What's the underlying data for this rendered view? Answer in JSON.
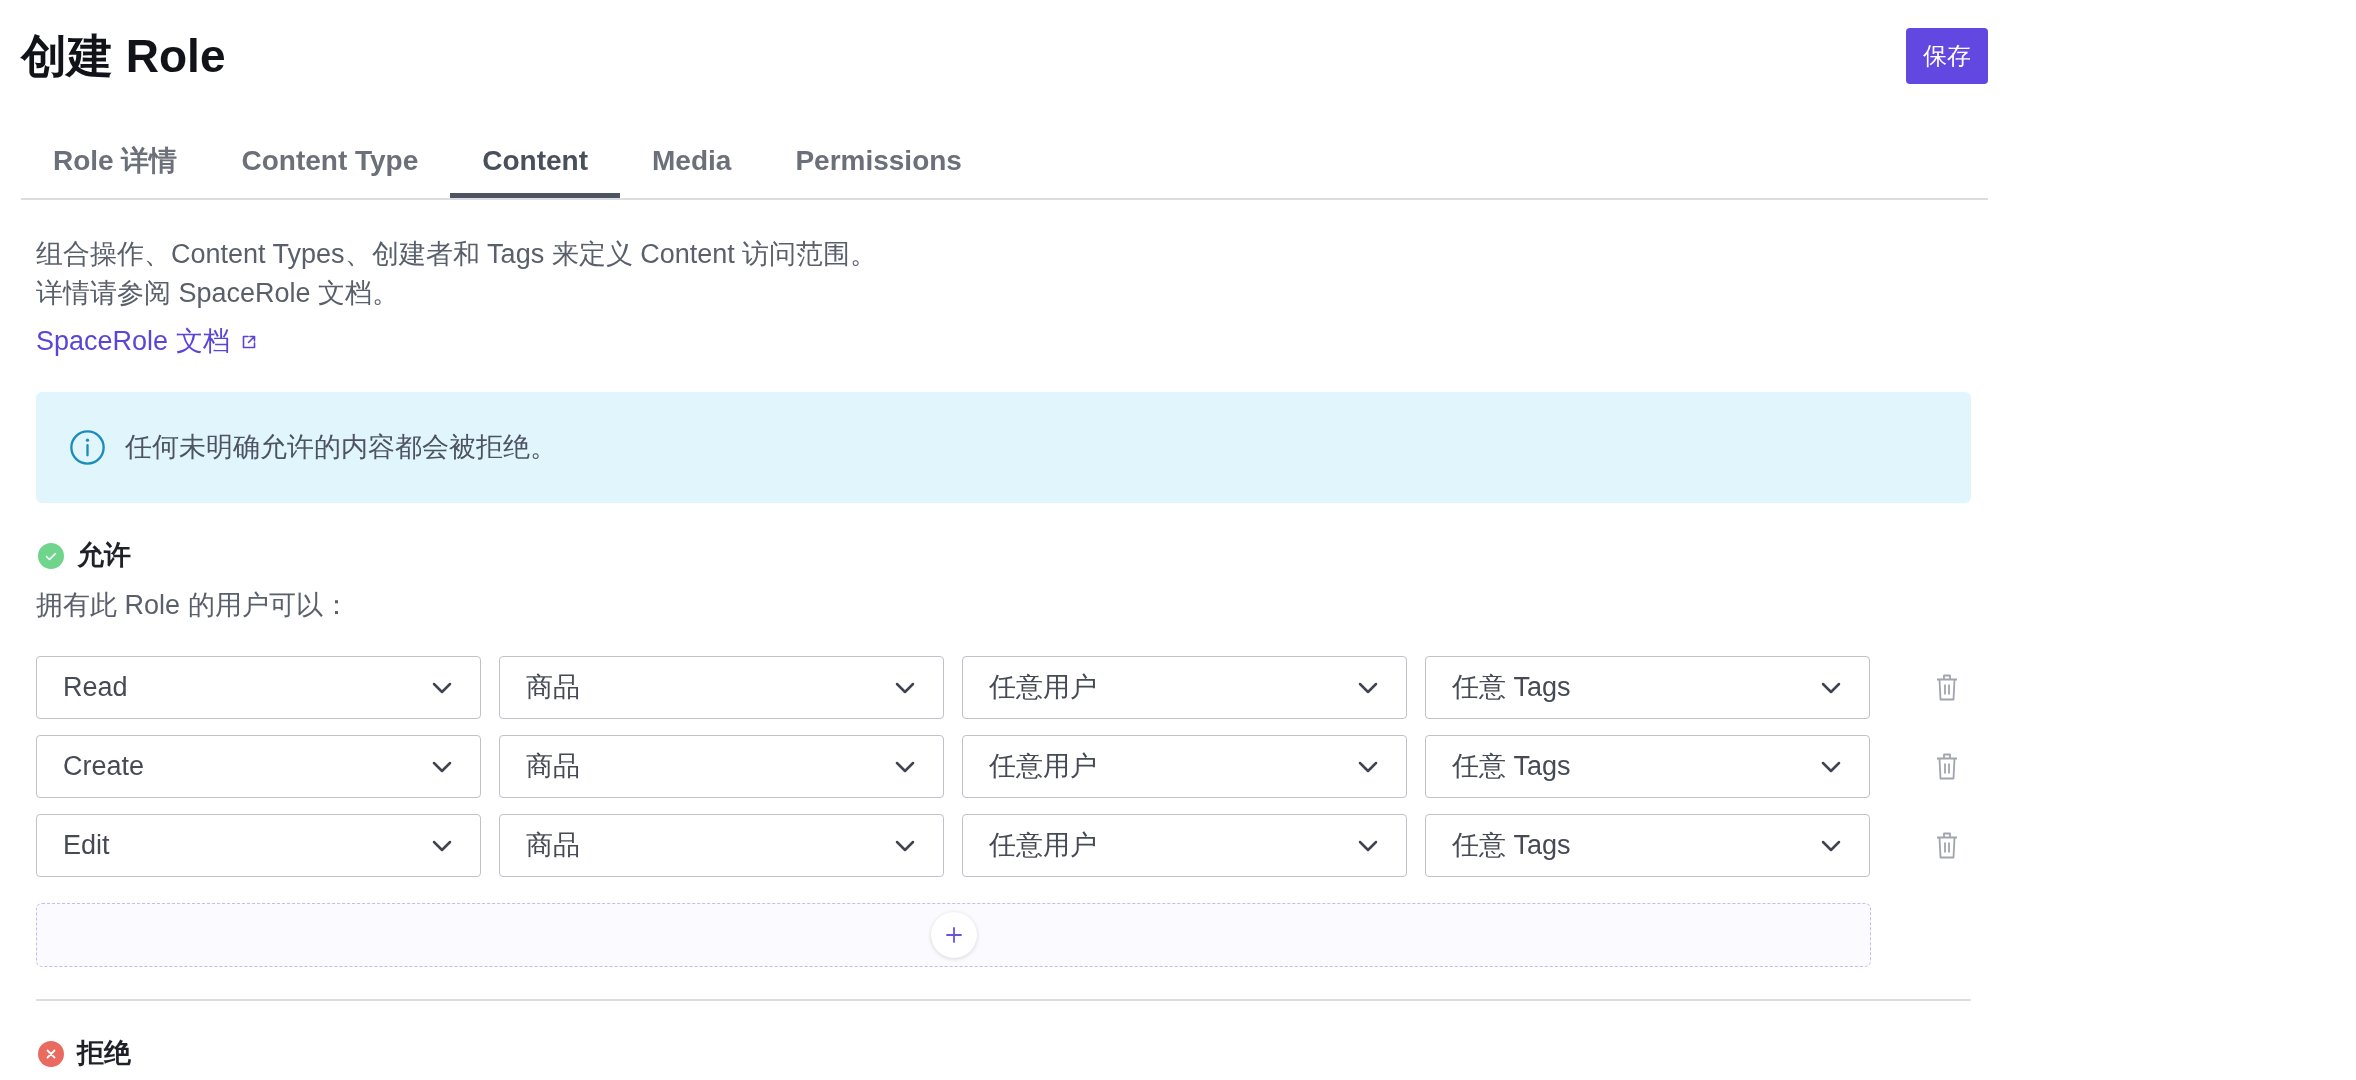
{
  "header": {
    "title": "创建 Role",
    "save_button": "保存"
  },
  "tabs": [
    {
      "label": "Role 详情",
      "selected": false
    },
    {
      "label": "Content Type",
      "selected": false
    },
    {
      "label": "Content",
      "selected": true
    },
    {
      "label": "Media",
      "selected": false
    },
    {
      "label": "Permissions",
      "selected": false
    }
  ],
  "intro": {
    "lines": [
      "组合操作、Content Types、创建者和 Tags 来定义 Content 访问范围。",
      "详情请参阅 SpaceRole 文档。"
    ],
    "link": "SpaceRole 文档"
  },
  "notice": {
    "text": "任何未明确允许的内容都会被拒绝。"
  },
  "sections": [
    {
      "kind": "allow",
      "title": "允许",
      "subtitle": "拥有此 Role 的用户可以：",
      "rules": [
        {
          "fields": [
            "Read",
            "商品",
            "任意用户",
            "任意 Tags"
          ]
        },
        {
          "fields": [
            "Create",
            "商品",
            "任意用户",
            "任意 Tags"
          ]
        },
        {
          "fields": [
            "Edit",
            "商品",
            "任意用户",
            "任意 Tags"
          ]
        }
      ]
    },
    {
      "kind": "deny",
      "title": "拒绝"
    }
  ]
}
